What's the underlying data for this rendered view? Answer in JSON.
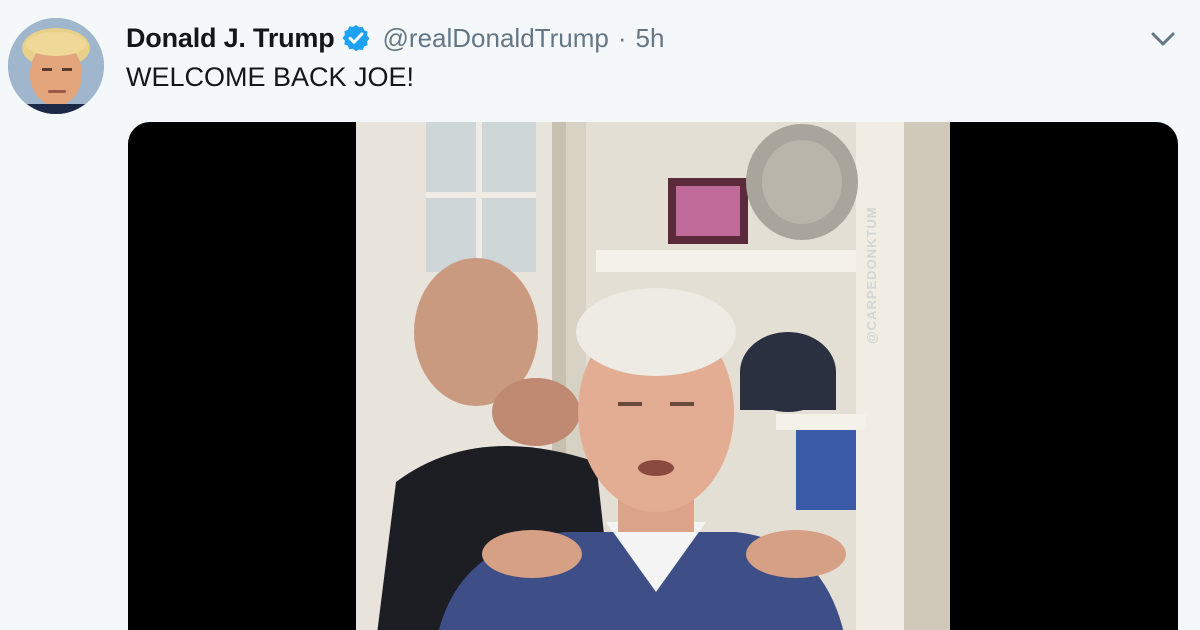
{
  "tweet": {
    "display_name": "Donald J. Trump",
    "verified": true,
    "handle": "@realDonaldTrump",
    "separator": "·",
    "timestamp": "5h",
    "text": "WELCOME BACK JOE!",
    "avatar_icon": "profile-photo",
    "menu_icon": "chevron-down-icon",
    "verified_icon": "verified-badge-icon"
  },
  "media": {
    "type": "video",
    "watermark": "@CARPEDONKTUM"
  },
  "colors": {
    "name": "#14171a",
    "secondary": "#657786",
    "verified": "#1da1f2",
    "background": "#f5f8fa",
    "media_letterbox": "#000000"
  }
}
